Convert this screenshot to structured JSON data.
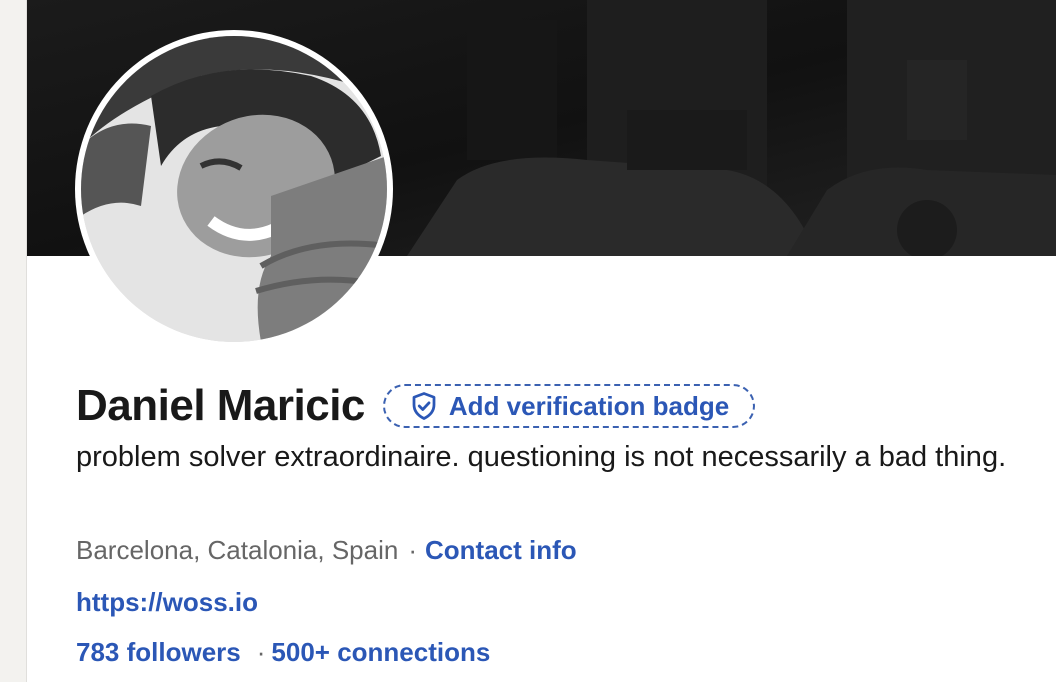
{
  "profile": {
    "name": "Daniel Maricic",
    "verification_badge_label": "Add verification badge",
    "headline": "problem solver extraordinaire. questioning is not necessarily a bad thing.",
    "location": "Barcelona, Catalonia, Spain",
    "separator": "·",
    "contact_info_label": "Contact info",
    "website": "https://woss.io",
    "followers": "783 followers",
    "connections": "500+ connections"
  },
  "icons": {
    "verification": "shield-check-icon"
  },
  "colors": {
    "link": "#2b57b6",
    "text": "#191919",
    "muted": "#666666",
    "banner": "#151515"
  }
}
